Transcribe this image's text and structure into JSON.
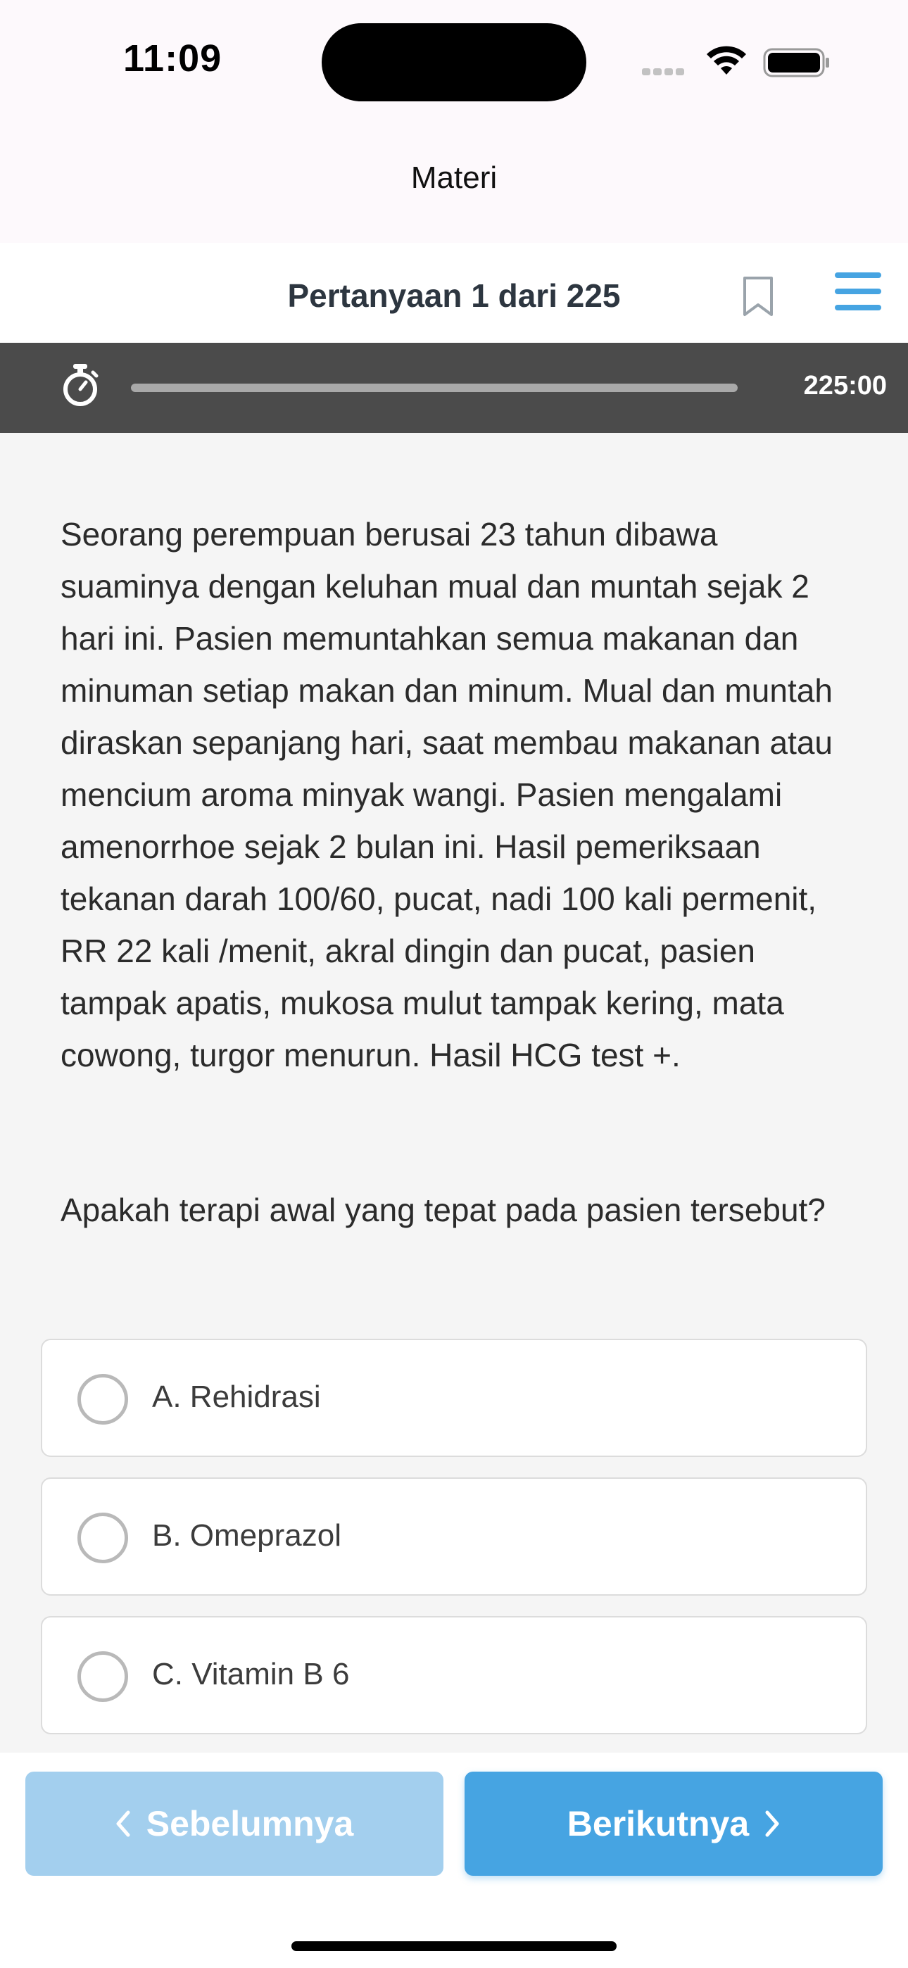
{
  "status_bar": {
    "time": "11:09"
  },
  "nav": {
    "title": "Materi"
  },
  "question_header": {
    "counter": "Pertanyaan 1 dari 225"
  },
  "timer": {
    "time_left": "225:00",
    "progress": 1.0
  },
  "question": {
    "text": "Seorang perempuan berusai 23 tahun dibawa suaminya dengan keluhan mual dan muntah sejak 2 hari ini. Pasien memuntahkan semua makanan dan minuman setiap makan dan minum. Mual dan muntah diraskan sepanjang hari, saat membau makanan atau mencium aroma minyak wangi. Pasien mengalami amenorrhoe sejak 2 bulan ini. Hasil pemeriksaan tekanan darah 100/60, pucat, nadi 100 kali permenit, RR 22 kali /menit, akral dingin dan pucat, pasien tampak apatis, mukosa mulut tampak kering, mata cowong, turgor menurun. Hasil HCG test +.",
    "prompt": "Apakah terapi awal yang tepat pada pasien tersebut?"
  },
  "options": [
    {
      "label": "A. Rehidrasi"
    },
    {
      "label": "B. Omeprazol"
    },
    {
      "label": "C. Vitamin B 6"
    }
  ],
  "footer": {
    "prev_label": "Sebelumnya",
    "next_label": "Berikutnya"
  },
  "colors": {
    "accent": "#46a4e2",
    "accent_light": "#a3cfee",
    "timer_bar": "#4b4b4b"
  }
}
